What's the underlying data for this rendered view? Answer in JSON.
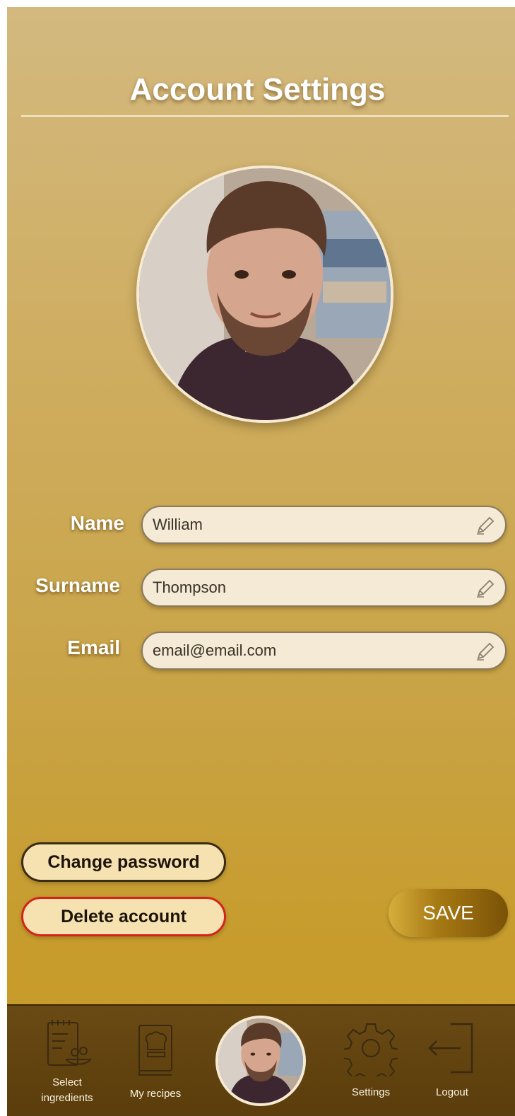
{
  "header": {
    "title": "Account Settings"
  },
  "profile": {
    "avatar_icon": "person-avatar-photo"
  },
  "form": {
    "name_label": "Name",
    "name_value": "William",
    "surname_label": "Surname",
    "surname_value": "Thompson",
    "email_label": "Email",
    "email_value": "email@email.com",
    "edit_icon": "pencil-icon"
  },
  "actions": {
    "change_password": "Change password",
    "delete_account": "Delete account",
    "save": "SAVE"
  },
  "nav": {
    "select_ingredients_line1": "Select",
    "select_ingredients_line2": "ingredients",
    "my_recipes": "My recipes",
    "settings": "Settings",
    "logout": "Logout"
  },
  "colors": {
    "background_top": "#d3b97f",
    "background_bottom": "#c69a28",
    "navbar": "#5a3d0c",
    "delete_border": "#d4241a",
    "field_fill": "#f4ead6"
  }
}
